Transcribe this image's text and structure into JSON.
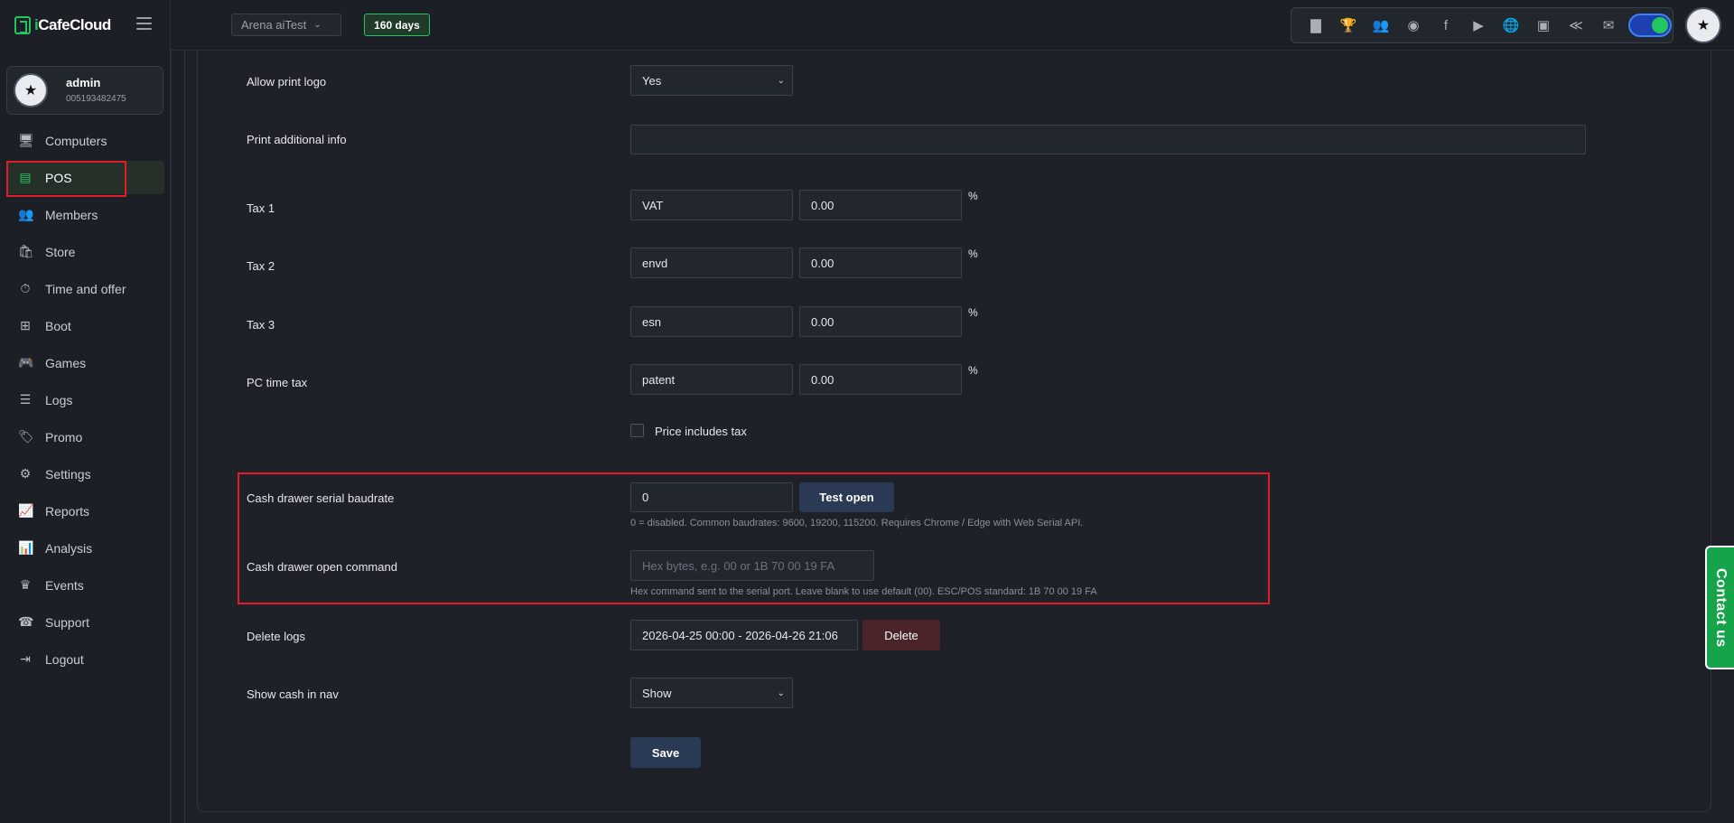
{
  "brand": {
    "logo_prefix": "i",
    "logo_name": "CafeCloud"
  },
  "user": {
    "name": "admin",
    "id": "005193482475"
  },
  "nav": {
    "items": [
      {
        "label": "Computers",
        "icon": "monitor-icon",
        "glyph": "🖥"
      },
      {
        "label": "POS",
        "icon": "pos-icon",
        "glyph": "▤"
      },
      {
        "label": "Members",
        "icon": "members-icon",
        "glyph": "👥"
      },
      {
        "label": "Store",
        "icon": "store-icon",
        "glyph": "🛍"
      },
      {
        "label": "Time and offer",
        "icon": "timer-icon",
        "glyph": "⏱"
      },
      {
        "label": "Boot",
        "icon": "windows-icon",
        "glyph": "⊞"
      },
      {
        "label": "Games",
        "icon": "gamepad-icon",
        "glyph": "🎮"
      },
      {
        "label": "Logs",
        "icon": "list-icon",
        "glyph": "☰"
      },
      {
        "label": "Promo",
        "icon": "tag-icon",
        "glyph": "🏷"
      },
      {
        "label": "Settings",
        "icon": "gear-icon",
        "glyph": "⚙"
      },
      {
        "label": "Reports",
        "icon": "line-chart-icon",
        "glyph": "📈"
      },
      {
        "label": "Analysis",
        "icon": "area-chart-icon",
        "glyph": "📊"
      },
      {
        "label": "Events",
        "icon": "crown-icon",
        "glyph": "♛"
      },
      {
        "label": "Support",
        "icon": "phone-icon",
        "glyph": "☎"
      },
      {
        "label": "Logout",
        "icon": "logout-icon",
        "glyph": "⇥"
      }
    ],
    "active": "POS"
  },
  "topbar": {
    "branch": "Arena aiTest",
    "days": "160 days",
    "icons": [
      {
        "name": "ranking-icon",
        "glyph": "▇"
      },
      {
        "name": "trophy-icon",
        "glyph": "🏆"
      },
      {
        "name": "community-icon",
        "glyph": "👥"
      },
      {
        "name": "rss-icon",
        "glyph": "◉"
      },
      {
        "name": "facebook-icon",
        "glyph": "f"
      },
      {
        "name": "youtube-icon",
        "glyph": "▶"
      },
      {
        "name": "globe-icon",
        "glyph": "🌐"
      },
      {
        "name": "icafe-icon",
        "glyph": "▣"
      },
      {
        "name": "handshake-icon",
        "glyph": "≪"
      },
      {
        "name": "mail-icon",
        "glyph": "✉"
      }
    ]
  },
  "form": {
    "allow_print_logo": {
      "label": "Allow print logo",
      "value": "Yes"
    },
    "print_additional_info": {
      "label": "Print additional info",
      "value": ""
    },
    "taxes": [
      {
        "label": "Tax 1",
        "name": "VAT",
        "rate": "0.00"
      },
      {
        "label": "Tax 2",
        "name": "envd",
        "rate": "0.00"
      },
      {
        "label": "Tax 3",
        "name": "esn",
        "rate": "0.00"
      },
      {
        "label": "PC time tax",
        "name": "patent",
        "rate": "0.00"
      }
    ],
    "percent_sign": "%",
    "price_includes_tax": {
      "label": "Price includes tax",
      "checked": false
    },
    "cash_drawer_baudrate": {
      "label": "Cash drawer serial baudrate",
      "value": "0",
      "button": "Test open",
      "help": "0 = disabled. Common baudrates: 9600, 19200, 115200. Requires Chrome / Edge with Web Serial API."
    },
    "cash_drawer_command": {
      "label": "Cash drawer open command",
      "value": "",
      "placeholder": "Hex bytes, e.g. 00 or 1B 70 00 19 FA",
      "help": "Hex command sent to the serial port. Leave blank to use default (00). ESC/POS standard: 1B 70 00 19 FA"
    },
    "delete_logs": {
      "label": "Delete logs",
      "range": "2026-04-25 00:00 - 2026-04-26 21:06",
      "button": "Delete"
    },
    "show_cash_in_nav": {
      "label": "Show cash in nav",
      "value": "Show"
    },
    "save": "Save"
  },
  "contact": "Contact us",
  "colors": {
    "accent_green": "#22c55e",
    "highlight_red": "#e11d2a",
    "button_blue": "#2a3a55"
  }
}
